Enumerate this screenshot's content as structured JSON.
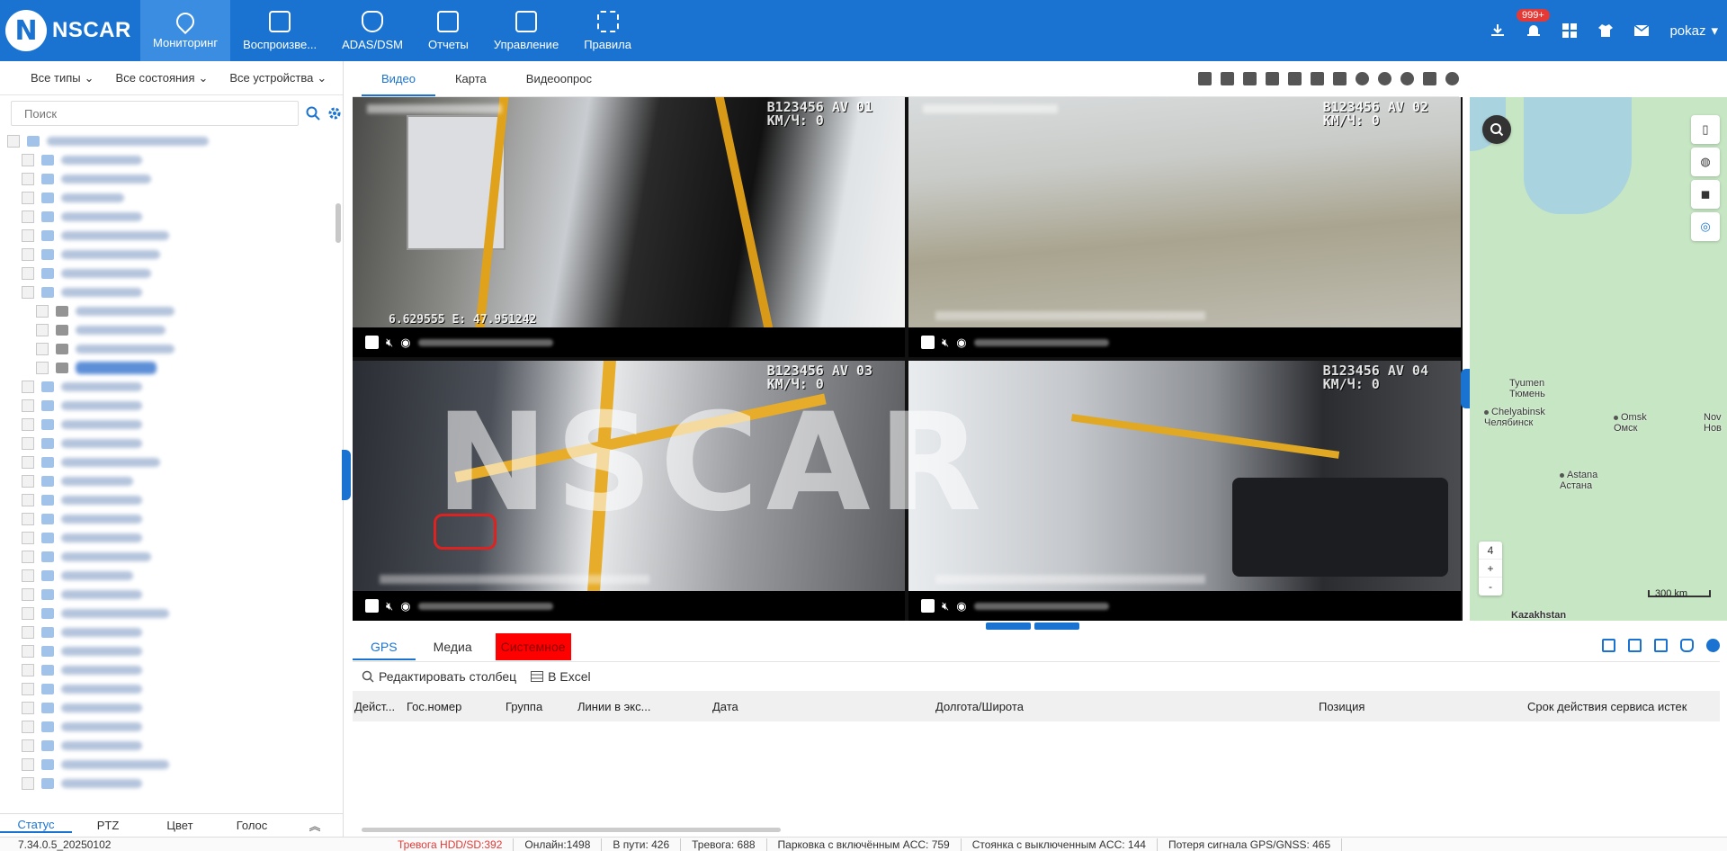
{
  "app": {
    "logo_text": "NSCAR",
    "logo_mark": "N",
    "nav": [
      {
        "label": "Мониторинг",
        "icon": "map-pin-icon",
        "active": true
      },
      {
        "label": "Воспроизве...",
        "icon": "playback-icon",
        "active": false
      },
      {
        "label": "ADAS/DSM",
        "icon": "shield-icon",
        "active": false
      },
      {
        "label": "Отчеты",
        "icon": "chart-icon",
        "active": false
      },
      {
        "label": "Управление",
        "icon": "manage-icon",
        "active": false
      },
      {
        "label": "Правила",
        "icon": "rules-icon",
        "active": false
      }
    ],
    "alarm_badge": "999+",
    "user": "pokaz",
    "accent_color": "#1a73d1"
  },
  "left_panel": {
    "filters": [
      "Все типы",
      "Все состояния",
      "Все устройства"
    ],
    "search_placeholder": "Поиск",
    "tabs": [
      "Статус",
      "PTZ",
      "Цвет",
      "Голос"
    ],
    "active_tab": "Статус"
  },
  "video": {
    "tabs": [
      "Видео",
      "Карта",
      "Видеоопрос"
    ],
    "active_tab": "Видео",
    "channels": [
      {
        "plate": "B123456 AV 01",
        "speed_label": "КМ/Ч:",
        "speed": "0"
      },
      {
        "plate": "B123456 AV 02",
        "speed_label": "КМ/Ч:",
        "speed": "0"
      },
      {
        "plate": "B123456 AV 03",
        "speed_label": "КМ/Ч:",
        "speed": "0"
      },
      {
        "plate": "B123456 AV 04",
        "speed_label": "КМ/Ч:",
        "speed": "0"
      }
    ],
    "overlay_coords": "6.629555 E: 47.951242",
    "watermark": "NSCAR"
  },
  "map": {
    "zoom_level": "4",
    "zoom_in": "+",
    "zoom_out": "-",
    "scale_label": "300 km",
    "cities": [
      {
        "name": "Tyumen",
        "local": "Тюмень"
      },
      {
        "name": "Chelyabinsk",
        "local": "Челябинск"
      },
      {
        "name": "Omsk",
        "local": "Омск"
      },
      {
        "name": "Nov",
        "local": "Нов"
      },
      {
        "name": "Astana",
        "local": "Астана"
      },
      {
        "name": "Kazakhstan",
        "local": ""
      }
    ]
  },
  "bottom": {
    "tabs": [
      "GPS",
      "Медиа",
      "Системное"
    ],
    "active_tab": "GPS",
    "edit_columns": "Редактировать столбец",
    "export": "В Excel",
    "columns": [
      "Дейст...",
      "Гос.номер",
      "Группа",
      "Линии в экс...",
      "Дата",
      "Долгота/Широта",
      "Позиция",
      "Срок действия сервиса истек"
    ]
  },
  "status_bar": {
    "version": "7.34.0.5_20250102",
    "items": [
      {
        "text": "Тревога HDD/SD:392",
        "alarm": true
      },
      {
        "text": "Онлайн:1498",
        "alarm": false
      },
      {
        "text": "В пути: 426",
        "alarm": false
      },
      {
        "text": "Тревога: 688",
        "alarm": false
      },
      {
        "text": "Парковка с включённым ACC: 759",
        "alarm": false
      },
      {
        "text": "Стоянка с выключенным ACC: 144",
        "alarm": false
      },
      {
        "text": "Потеря сигнала GPS/GNSS: 465",
        "alarm": false
      }
    ]
  }
}
